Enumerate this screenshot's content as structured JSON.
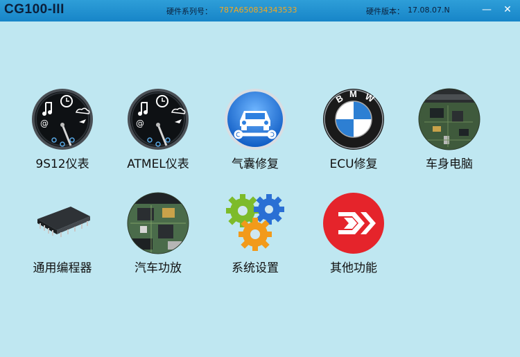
{
  "app": {
    "title": "CG100-III",
    "serial_label": "硬件系列号：",
    "serial_value": "787A650834343533",
    "version_label": "硬件版本：",
    "version_value": "17.08.07.N"
  },
  "window_buttons": {
    "minimize": "—",
    "close": "✕"
  },
  "menu": {
    "row1": [
      {
        "label": "9S12仪表",
        "icon": "gauge-icon"
      },
      {
        "label": "ATMEL仪表",
        "icon": "gauge-icon"
      },
      {
        "label": "气囊修复",
        "icon": "car-wrench-icon"
      },
      {
        "label": "ECU修复",
        "icon": "bmw-logo-icon"
      },
      {
        "label": "车身电脑",
        "icon": "circuit-board-icon"
      }
    ],
    "row2": [
      {
        "label": "通用编程器",
        "icon": "chip-icon"
      },
      {
        "label": "汽车功放",
        "icon": "circuit-board-icon"
      },
      {
        "label": "系统设置",
        "icon": "gears-icon"
      },
      {
        "label": "其他功能",
        "icon": "arrow-logo-icon"
      }
    ]
  },
  "colors": {
    "titlebar": "#1785c8",
    "background": "#bfe7f1",
    "serial_value": "#f6a81e",
    "red_icon": "#e5242b",
    "blue_icon": "#1b78d8"
  }
}
